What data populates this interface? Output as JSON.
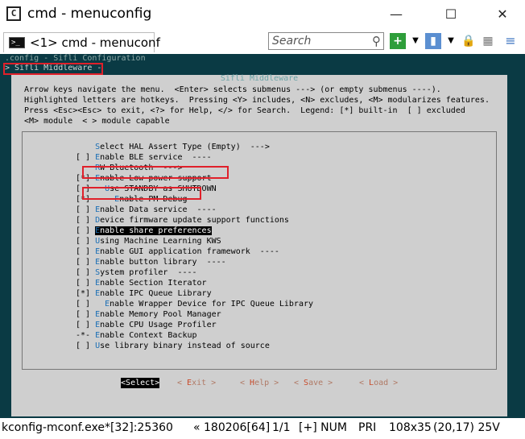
{
  "window": {
    "title": "cmd - menuconfig",
    "minimize_glyph": "—",
    "maximize_glyph": "☐",
    "close_glyph": "✕"
  },
  "tab": {
    "label": "<1> cmd - menuconf",
    "icon": "console-icon"
  },
  "search": {
    "placeholder": "Search"
  },
  "toolbar_icons": [
    "add-icon",
    "dropdown-icon",
    "panel-icon",
    "dropdown-icon",
    "lock-icon",
    "settings-icon",
    "menu-icon"
  ],
  "terminal": {
    "config_line": ".config - Sifli Configuration",
    "breadcrumb": "> Sifli Middleware -",
    "dialog_title": " Sifli Middleware ",
    "help_lines": [
      "Arrow keys navigate the menu.  <Enter> selects submenus ---> (or empty submenus ----).",
      "Highlighted letters are hotkeys.  Pressing <Y> includes, <N> excludes, <M> modularizes features.",
      "Press <Esc><Esc> to exit, <?> for Help, </> for Search.  Legend: [*] built-in  [ ] excluded",
      "<M> module  < > module capable"
    ],
    "items": [
      {
        "prefix": "    ",
        "hotkey": "S",
        "rest": "elect HAL Assert Type (Empty)  --->"
      },
      {
        "prefix": "[ ] ",
        "hotkey": "E",
        "rest": "nable BLE service  ----"
      },
      {
        "prefix": "    ",
        "hotkey": "R",
        "rest": "W Bluetooth  --->"
      },
      {
        "prefix": "[*] ",
        "hotkey": "E",
        "rest": "nable Low power support"
      },
      {
        "prefix": "[ ]   ",
        "hotkey": "U",
        "rest": "se STANDBY as SHUTDOWN"
      },
      {
        "prefix": "[*]     ",
        "hotkey": "E",
        "rest": "nable PM Debug"
      },
      {
        "prefix": "[ ] ",
        "hotkey": "E",
        "rest": "nable Data service  ----"
      },
      {
        "prefix": "[ ] ",
        "hotkey": "D",
        "rest": "evice firmware update support functions"
      },
      {
        "prefix": "[ ] ",
        "hotkey": "E",
        "rest": "nable share preferences",
        "selected": true
      },
      {
        "prefix": "[ ] ",
        "hotkey": "U",
        "rest": "sing Machine Learning KWS"
      },
      {
        "prefix": "[ ] ",
        "hotkey": "E",
        "rest": "nable GUI application framework  ----"
      },
      {
        "prefix": "[ ] ",
        "hotkey": "E",
        "rest": "nable button library  ----"
      },
      {
        "prefix": "[ ] ",
        "hotkey": "S",
        "rest": "ystem profiler  ----"
      },
      {
        "prefix": "[ ] ",
        "hotkey": "E",
        "rest": "nable Section Iterator"
      },
      {
        "prefix": "[*] ",
        "hotkey": "E",
        "rest": "nable IPC Queue Library"
      },
      {
        "prefix": "[ ]   ",
        "hotkey": "E",
        "rest": "nable Wrapper Device for IPC Queue Library"
      },
      {
        "prefix": "[ ] ",
        "hotkey": "E",
        "rest": "nable Memory Pool Manager"
      },
      {
        "prefix": "[ ] ",
        "hotkey": "E",
        "rest": "nable CPU Usage Profiler"
      },
      {
        "prefix": "-*- ",
        "hotkey": "E",
        "rest": "nable Context Backup"
      },
      {
        "prefix": "[ ] ",
        "hotkey": "U",
        "rest": "se library binary instead of source"
      }
    ],
    "buttons": [
      {
        "open": "<",
        "hotkey": "S",
        "rest": "elect",
        "close": ">",
        "active": true
      },
      {
        "open": "< ",
        "hotkey": "E",
        "rest": "xit",
        "close": " >"
      },
      {
        "open": "< ",
        "hotkey": "H",
        "rest": "elp",
        "close": " >"
      },
      {
        "open": "< ",
        "hotkey": "S",
        "rest": "ave",
        "close": " >"
      },
      {
        "open": "< ",
        "hotkey": "L",
        "rest": "oad",
        "close": " >"
      }
    ]
  },
  "status": {
    "process": "kconfig-mconf.exe*[32]:25360",
    "build": "« 180206[64]",
    "pos": "1/1",
    "ins": "[+] NUM",
    "pri": "PRI",
    "size": "108x35",
    "cursor": "(20,17) 25V"
  }
}
